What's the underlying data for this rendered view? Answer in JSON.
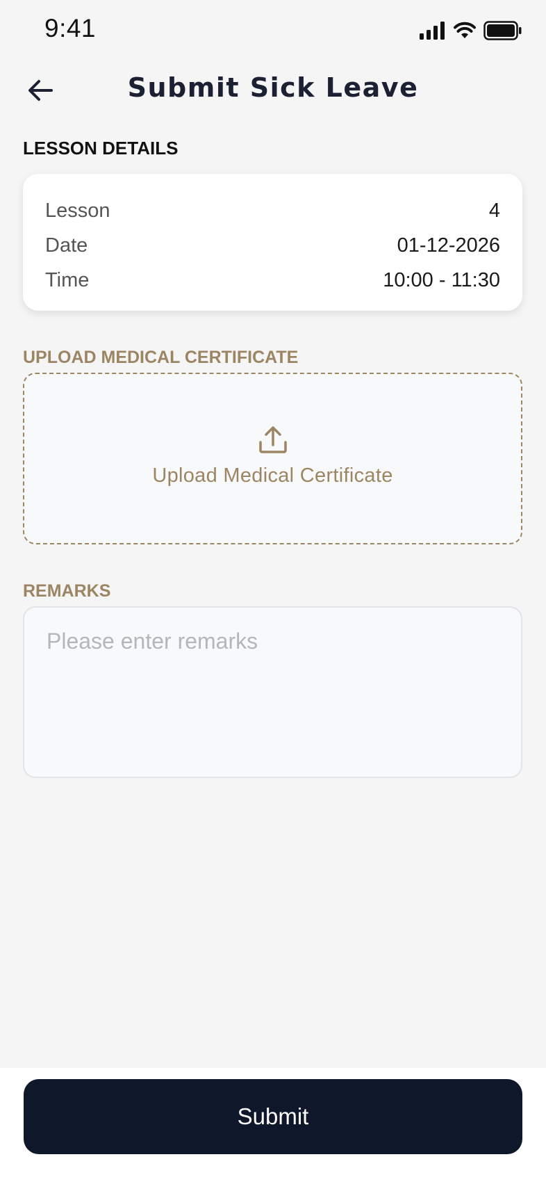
{
  "status_bar": {
    "time": "9:41"
  },
  "header": {
    "title": "Submit Sick Leave",
    "back_icon": "arrow-left-icon"
  },
  "lesson_details": {
    "section_label": "LESSON DETAILS",
    "rows": [
      {
        "key": "Lesson",
        "value": "4"
      },
      {
        "key": "Date",
        "value": "01-12-2026"
      },
      {
        "key": "Time",
        "value": "10:00 - 11:30"
      }
    ]
  },
  "upload": {
    "section_label": "UPLOAD MEDICAL CERTIFICATE",
    "button_label": "Upload Medical Certificate",
    "icon": "upload-icon"
  },
  "remarks": {
    "section_label": "REMARKS",
    "placeholder": "Please enter remarks",
    "value": ""
  },
  "submit": {
    "label": "Submit"
  },
  "colors": {
    "background": "#f5f5f5",
    "accent_gold": "#9c8562",
    "primary_dark": "#0f172a",
    "title": "#1b2033"
  }
}
